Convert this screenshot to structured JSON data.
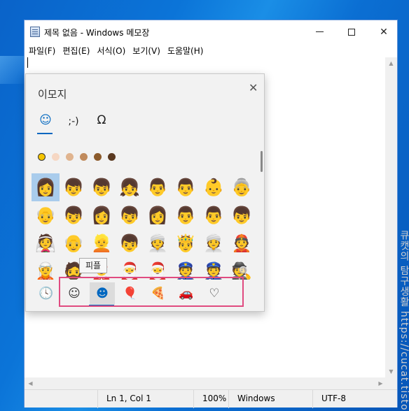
{
  "window": {
    "title": "제목 없음 - Windows 메모장",
    "controls": {
      "minimize": "minimize-icon",
      "maximize": "maximize-icon",
      "close": "close-icon"
    }
  },
  "menu": [
    "파일(F)",
    "편집(E)",
    "서식(O)",
    "보기(V)",
    "도움말(H)"
  ],
  "editor": {
    "text": ""
  },
  "status_bar": {
    "position": "Ln 1, Col 1",
    "zoom": "100%",
    "line_ending": "Windows (CRLF)",
    "encoding": "UTF-8"
  },
  "watermark": "큐캣의 탐구생활 https://cucat.tistory.com/",
  "emoji_panel": {
    "title": "이모지",
    "close_icon": "close-icon",
    "tabs": [
      {
        "label": "☺",
        "name": "emoji"
      },
      {
        "label": ";-)",
        "name": "kaomoji"
      },
      {
        "label": "Ω",
        "name": "symbols"
      }
    ],
    "skin_tones": [
      "#f5c400",
      "#f6d7c3",
      "#e0b48f",
      "#c08a5c",
      "#8b5a2b",
      "#5a3920"
    ],
    "emoji_rows": [
      [
        "👩",
        "👦",
        "👦",
        "👧",
        "👨",
        "👨",
        "👶",
        "👵"
      ],
      [
        "👴",
        "👦",
        "👩",
        "👦",
        "👩",
        "👨",
        "👨",
        "👦"
      ],
      [
        "👰",
        "👴",
        "👱",
        "👦",
        "👳",
        "🤴",
        "👳",
        "👲"
      ],
      [
        "🧝",
        "🧔",
        "🤶",
        "🎅",
        "🎅",
        "👮",
        "👮",
        "🕵"
      ]
    ],
    "tooltip": "피플",
    "category_bar": [
      {
        "label": "🕓",
        "name": "recent-icon"
      },
      {
        "label": "☺",
        "name": "smiley-icon"
      },
      {
        "label": "☻",
        "name": "people-icon"
      },
      {
        "label": "🎈",
        "name": "celebration-icon"
      },
      {
        "label": "🍕",
        "name": "food-icon"
      },
      {
        "label": "🚗",
        "name": "travel-icon"
      },
      {
        "label": "♡",
        "name": "heart-icon"
      }
    ],
    "colors": {
      "accent": "#0067c0",
      "highlight_box": "#e04b80",
      "selected_cell": "#a9ccec"
    }
  }
}
